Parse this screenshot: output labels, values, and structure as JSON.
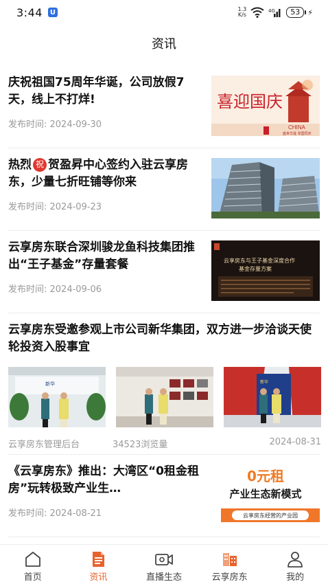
{
  "status_bar": {
    "time": "3:44",
    "app_badge": "U",
    "net_speed_value": "1.3",
    "net_speed_unit": "K/s",
    "battery": "53"
  },
  "header": {
    "title": "资讯"
  },
  "news": [
    {
      "title": "庆祝祖国75周年华诞，公司放假7天，线上不打烊!",
      "date": "发布时间:  2024-09-30",
      "thumb_text": "喜迎国庆",
      "thumb_sub": "CHINA",
      "thumb_sub2": "盛世华诞 举国同庆"
    },
    {
      "title_pre": "热烈",
      "title_badge": "祝",
      "title_post": "贺盈昇中心签约入驻云享房东，少量七折旺铺等你来",
      "date": "发布时间:  2024-09-23"
    },
    {
      "title": "云享房东联合深圳骏龙鱼科技集团推出“王子基金”存量套餐",
      "date": "发布时间:  2024-09-06",
      "thumb_line1": "云享房东与王子基金深度合作",
      "thumb_line2": "基金存量方案"
    },
    {
      "title": "云享房东受邀参观上市公司新华集团，双方进一步洽谈天使轮投资入股事宜",
      "author": "云享房东管理后台",
      "views": "34523浏览量",
      "date": "2024-08-31"
    },
    {
      "title": "《云享房东》推出：大湾区“0租金租房”玩转极致产业生…",
      "date": "发布时间:  2024-08-21",
      "thumb_line1": "0元租",
      "thumb_line2": "产业生态新模式",
      "thumb_line3": "云享房东经营的产业园"
    }
  ],
  "tabs": [
    {
      "label": "首页",
      "icon": "home-icon",
      "active": false
    },
    {
      "label": "资讯",
      "icon": "news-icon",
      "active": true
    },
    {
      "label": "直播生态",
      "icon": "video-icon",
      "active": false
    },
    {
      "label": "云享房东",
      "icon": "building-icon",
      "active": false
    },
    {
      "label": "我的",
      "icon": "profile-icon",
      "active": false
    }
  ],
  "colors": {
    "accent": "#e8622d",
    "badge_red": "#e0382f",
    "date_gray": "#999999"
  }
}
